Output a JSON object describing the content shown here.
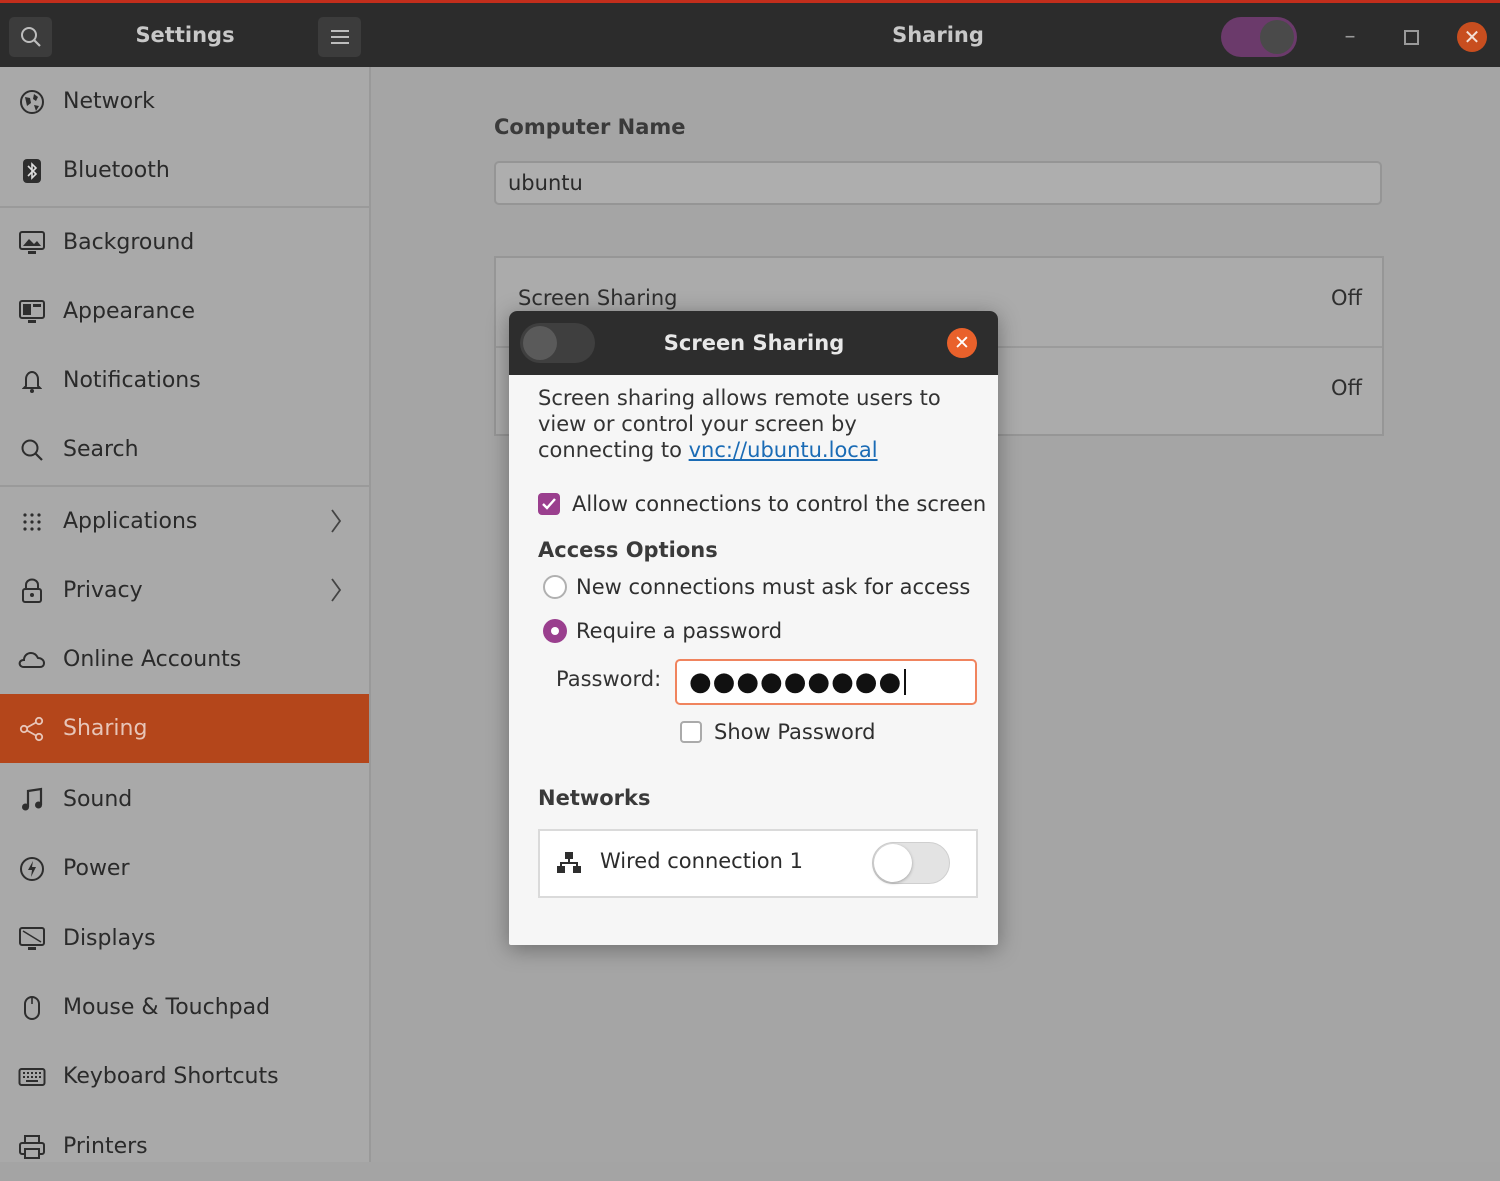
{
  "header": {
    "app_title": "Settings",
    "panel_title": "Sharing",
    "dark_mode_toggle": "on"
  },
  "sidebar": {
    "items": [
      {
        "label": "Network",
        "icon": "network-icon"
      },
      {
        "label": "Bluetooth",
        "icon": "bluetooth-icon"
      },
      {
        "label": "Background",
        "icon": "background-icon"
      },
      {
        "label": "Appearance",
        "icon": "appearance-icon"
      },
      {
        "label": "Notifications",
        "icon": "bell-icon"
      },
      {
        "label": "Search",
        "icon": "search-icon"
      },
      {
        "label": "Applications",
        "icon": "apps-grid-icon"
      },
      {
        "label": "Privacy",
        "icon": "lock-icon"
      },
      {
        "label": "Online Accounts",
        "icon": "cloud-icon"
      },
      {
        "label": "Sharing",
        "icon": "share-icon"
      },
      {
        "label": "Sound",
        "icon": "music-note-icon"
      },
      {
        "label": "Power",
        "icon": "power-icon"
      },
      {
        "label": "Displays",
        "icon": "display-icon"
      },
      {
        "label": "Mouse & Touchpad",
        "icon": "mouse-icon"
      },
      {
        "label": "Keyboard Shortcuts",
        "icon": "keyboard-icon"
      },
      {
        "label": "Printers",
        "icon": "printer-icon"
      }
    ],
    "active": "Sharing"
  },
  "main": {
    "computer_name_label": "Computer Name",
    "computer_name_value": "ubuntu",
    "rows": [
      {
        "label": "Screen Sharing",
        "value": "Off"
      },
      {
        "label": "",
        "value": "Off"
      }
    ]
  },
  "dialog": {
    "title": "Screen Sharing",
    "enabled": false,
    "description_before": "Screen sharing allows remote users to view or control your screen by connecting to ",
    "link": "vnc://ubuntu.local",
    "allow_control_label": "Allow connections to control the screen",
    "allow_control_checked": true,
    "access_options_title": "Access Options",
    "option_ask": "New connections must ask for access",
    "option_password": "Require a password",
    "selected_option": "Require a password",
    "password_label": "Password:",
    "password_masked": "●●●●●●●●●",
    "show_password_label": "Show Password",
    "show_password_checked": false,
    "networks_title": "Networks",
    "network_name": "Wired connection 1",
    "network_enabled": false
  },
  "colors": {
    "accent": "#b4461b",
    "checkbox_purple": "#9a3f8e",
    "close_orange": "#e9612b",
    "link_blue": "#1a6bb5"
  }
}
